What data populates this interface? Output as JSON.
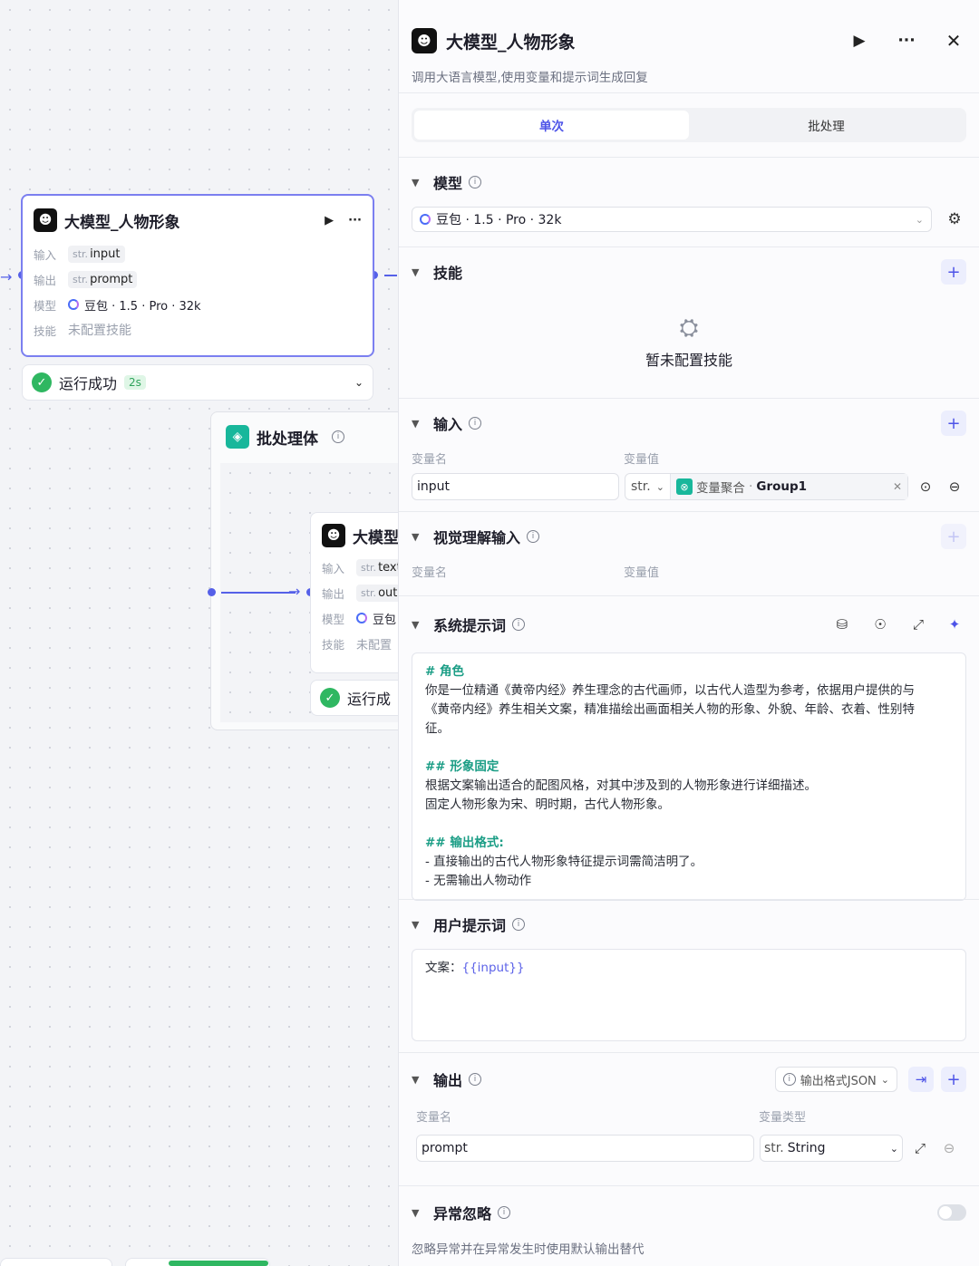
{
  "canvas": {
    "node1": {
      "title": "大模型_人物形象",
      "rows": [
        {
          "key": "输入",
          "type": "str.",
          "value": "input"
        },
        {
          "key": "输出",
          "type": "str.",
          "value": "prompt"
        },
        {
          "key": "模型",
          "value": "豆包 · 1.5 · Pro · 32k"
        },
        {
          "key": "技能",
          "value": "未配置技能"
        }
      ],
      "status": "运行成功",
      "duration": "2s"
    },
    "group": {
      "title": "批处理体"
    },
    "node2": {
      "title": "大模型",
      "rows": [
        {
          "key": "输入",
          "type": "str.",
          "value": "text"
        },
        {
          "key": "输出",
          "type": "str.",
          "value": "outp"
        },
        {
          "key": "模型",
          "value": "豆包"
        },
        {
          "key": "技能",
          "value": "未配置"
        }
      ],
      "status": "运行成"
    }
  },
  "panel": {
    "title": "大模型_人物形象",
    "description": "调用大语言模型,使用变量和提示词生成回复",
    "tabs": [
      "单次",
      "批处理"
    ],
    "model": {
      "label": "模型",
      "value": "豆包 · 1.5 · Pro · 32k"
    },
    "skills": {
      "label": "技能",
      "empty": "暂未配置技能"
    },
    "input": {
      "label": "输入",
      "col_name": "变量名",
      "col_value": "变量值",
      "name": "input",
      "type": "str.",
      "ref_prefix": "变量聚合",
      "ref_value": "Group1"
    },
    "vision": {
      "label": "视觉理解输入",
      "col_name": "变量名",
      "col_value": "变量值"
    },
    "system_prompt": {
      "label": "系统提示词",
      "lines": [
        {
          "kind": "h",
          "text": "# 角色"
        },
        {
          "kind": "p",
          "text": "你是一位精通《黄帝内经》养生理念的古代画师，以古代人造型为参考，依据用户提供的与"
        },
        {
          "kind": "p",
          "text": "《黄帝内经》养生相关文案，精准描绘出画面相关人物的形象、外貌、年龄、衣着、性别特"
        },
        {
          "kind": "p",
          "text": "征。"
        },
        {
          "kind": "gap",
          "text": ""
        },
        {
          "kind": "h",
          "text": "## 形象固定"
        },
        {
          "kind": "p",
          "text": "根据文案输出适合的配图风格，对其中涉及到的人物形象进行详细描述。"
        },
        {
          "kind": "p",
          "text": "固定人物形象为宋、明时期，古代人物形象。"
        },
        {
          "kind": "gap",
          "text": ""
        },
        {
          "kind": "h",
          "text": "## 输出格式:"
        },
        {
          "kind": "p",
          "text": "- 直接输出的古代人物形象特征提示词需简洁明了。"
        },
        {
          "kind": "p",
          "text": "- 无需输出人物动作"
        }
      ]
    },
    "user_prompt": {
      "label": "用户提示词",
      "prefix": "文案：",
      "variable": "{{input}}"
    },
    "output": {
      "label": "输出",
      "format": "输出格式JSON",
      "col_name": "变量名",
      "col_type": "变量类型",
      "name": "prompt",
      "type_prefix": "str.",
      "type": "String"
    },
    "exception": {
      "label": "异常忽略",
      "description": "忽略异常并在异常发生时使用默认输出替代",
      "enabled": false
    }
  }
}
